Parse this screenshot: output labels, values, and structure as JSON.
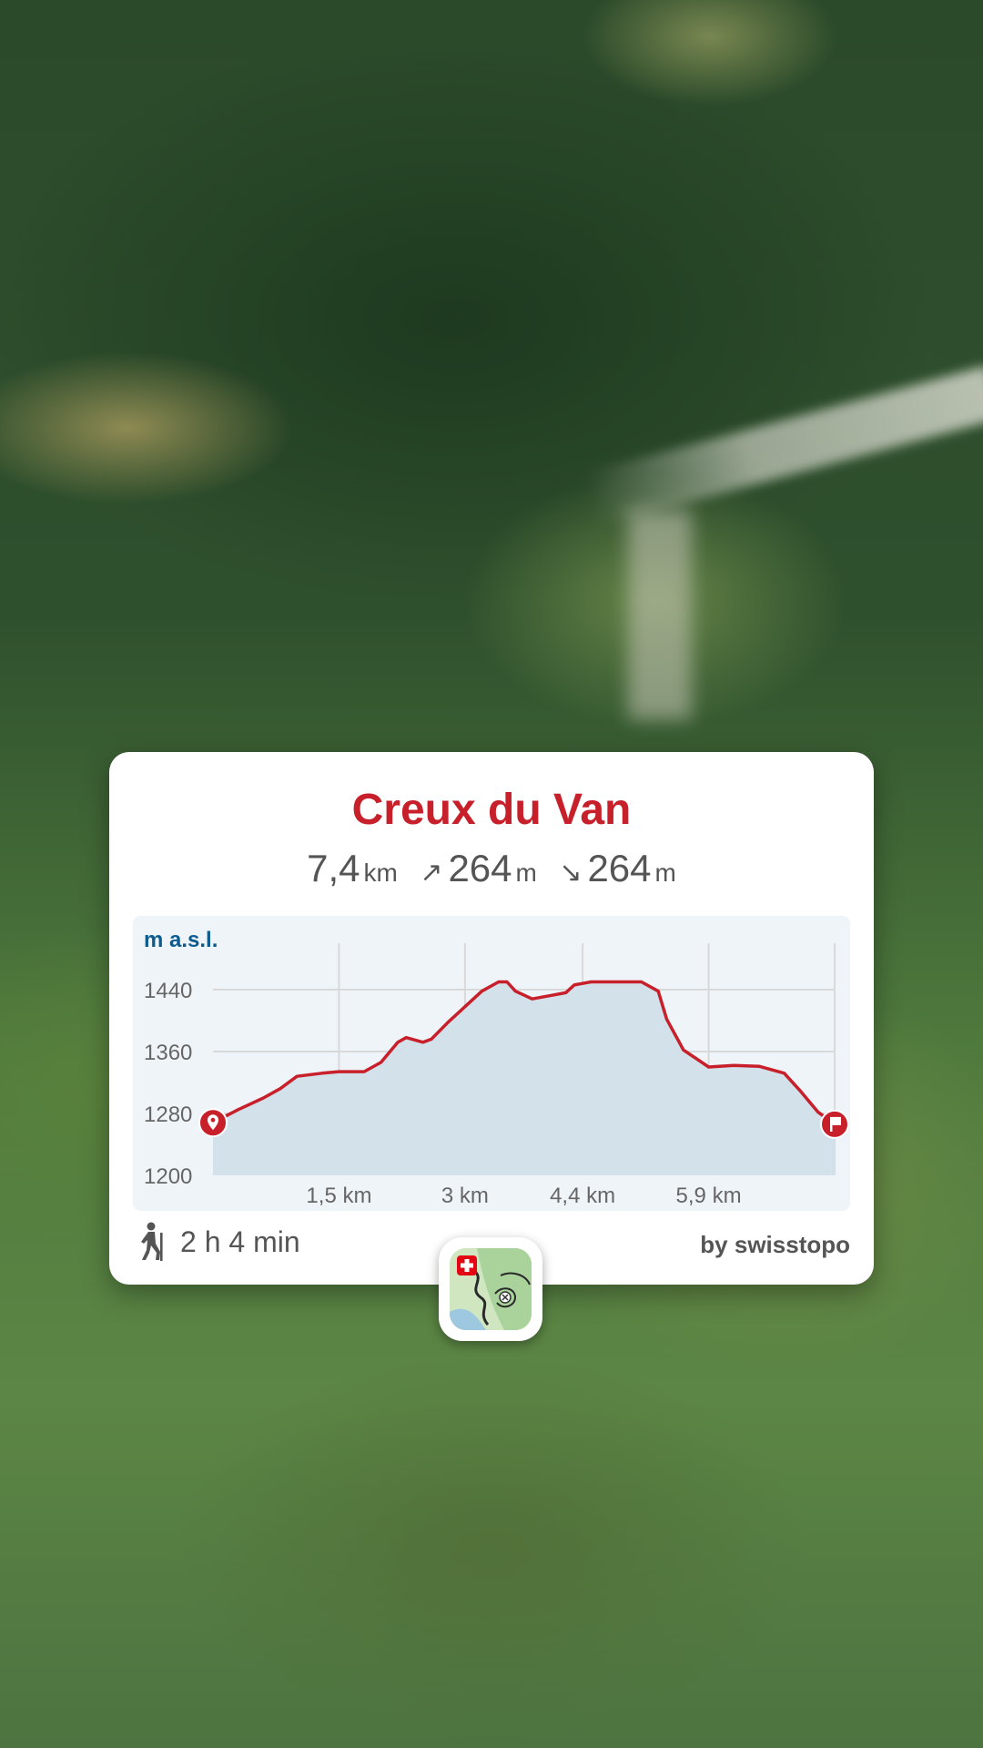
{
  "card": {
    "title": "Creux du Van",
    "distance_value": "7,4",
    "distance_unit": "km",
    "ascent_arrow": "↗",
    "ascent_value": "264",
    "ascent_unit": "m",
    "descent_arrow": "↘",
    "descent_value": "264",
    "descent_unit": "m",
    "duration": "2 h 4 min",
    "attribution": "by swisstopo"
  },
  "chart_data": {
    "type": "area",
    "ylabel": "m a.s.l.",
    "xlabel": "",
    "title": "",
    "ylim": [
      1200,
      1500
    ],
    "xlim": [
      0,
      7.4
    ],
    "y_ticks": [
      1200,
      1280,
      1360,
      1440
    ],
    "x_ticks": [
      {
        "value": 1.5,
        "label": "1,5 km"
      },
      {
        "value": 3.0,
        "label": "3 km"
      },
      {
        "value": 4.4,
        "label": "4,4 km"
      },
      {
        "value": 5.9,
        "label": "5,9 km"
      }
    ],
    "grid": true,
    "line_color": "#c8202b",
    "fill_color": "#d3e1eb",
    "start_marker": "location-pin-icon",
    "end_marker": "flag-icon",
    "x": [
      0,
      0.3,
      0.6,
      0.8,
      1.0,
      1.3,
      1.5,
      1.8,
      2.0,
      2.2,
      2.3,
      2.5,
      2.6,
      2.8,
      3.0,
      3.2,
      3.4,
      3.5,
      3.6,
      3.8,
      4.0,
      4.2,
      4.3,
      4.5,
      4.8,
      5.1,
      5.3,
      5.4,
      5.6,
      5.9,
      6.2,
      6.5,
      6.8,
      7.0,
      7.2,
      7.4
    ],
    "y": [
      1268,
      1285,
      1300,
      1312,
      1328,
      1332,
      1334,
      1334,
      1346,
      1372,
      1378,
      1372,
      1376,
      1398,
      1418,
      1438,
      1450,
      1450,
      1438,
      1428,
      1432,
      1436,
      1446,
      1450,
      1450,
      1450,
      1438,
      1402,
      1362,
      1340,
      1342,
      1341,
      1332,
      1308,
      1282,
      1266
    ]
  },
  "app_icon": {
    "name": "swisstopo-app-icon",
    "flag_color": "#e30613"
  }
}
